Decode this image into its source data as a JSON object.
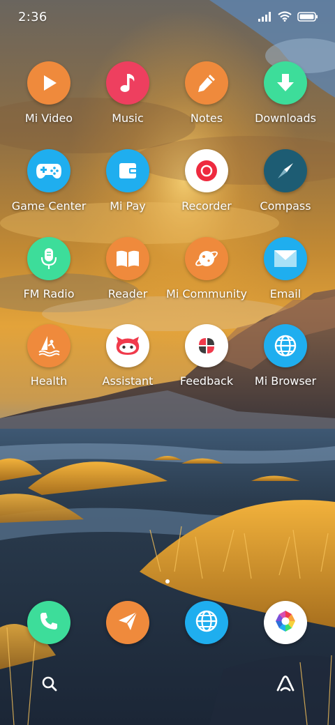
{
  "status_bar": {
    "time": "2:36",
    "icons": [
      "signal-icon",
      "wifi-icon",
      "battery-icon"
    ]
  },
  "apps": [
    {
      "label": "Mi Video",
      "icon": "play-icon",
      "color": "#EF8A3C"
    },
    {
      "label": "Music",
      "icon": "music-note-icon",
      "color": "#EE3F5F"
    },
    {
      "label": "Notes",
      "icon": "pencil-icon",
      "color": "#EF8A3C"
    },
    {
      "label": "Downloads",
      "icon": "download-arrow-icon",
      "color": "#3DDD9A"
    },
    {
      "label": "Game Center",
      "icon": "gamepad-icon",
      "color": "#1FAEEF"
    },
    {
      "label": "Mi Pay",
      "icon": "wallet-icon",
      "color": "#1FAEEF"
    },
    {
      "label": "Recorder",
      "icon": "record-icon",
      "color": "#FFFFFF"
    },
    {
      "label": "Compass",
      "icon": "compass-needle-icon",
      "color": "#1D5C73"
    },
    {
      "label": "FM Radio",
      "icon": "microphone-icon",
      "color": "#3DDD9A"
    },
    {
      "label": "Reader",
      "icon": "book-icon",
      "color": "#EF8A3C"
    },
    {
      "label": "Mi Community",
      "icon": "planet-icon",
      "color": "#EF8A3C"
    },
    {
      "label": "Email",
      "icon": "envelope-icon",
      "color": "#1FAEEF"
    },
    {
      "label": "Health",
      "icon": "windsurf-icon",
      "color": "#EF8A3C"
    },
    {
      "label": "Assistant",
      "icon": "assistant-face-icon",
      "color": "#FFFFFF"
    },
    {
      "label": "Feedback",
      "icon": "petals-icon",
      "color": "#FFFFFF"
    },
    {
      "label": "Mi Browser",
      "icon": "globe-icon",
      "color": "#1FAEEF"
    }
  ],
  "dock": [
    {
      "icon": "phone-icon",
      "color": "#3DDD9A"
    },
    {
      "icon": "paper-plane-icon",
      "color": "#EF8A3C"
    },
    {
      "icon": "globe-icon",
      "color": "#1FAEEF"
    },
    {
      "icon": "camera-aperture-icon",
      "color": "#FFFFFF"
    }
  ],
  "bottom_bar": {
    "left_icon": "search-icon",
    "right_icon": "app-vault-icon"
  },
  "pager": {
    "pages": 1,
    "current": 1
  }
}
